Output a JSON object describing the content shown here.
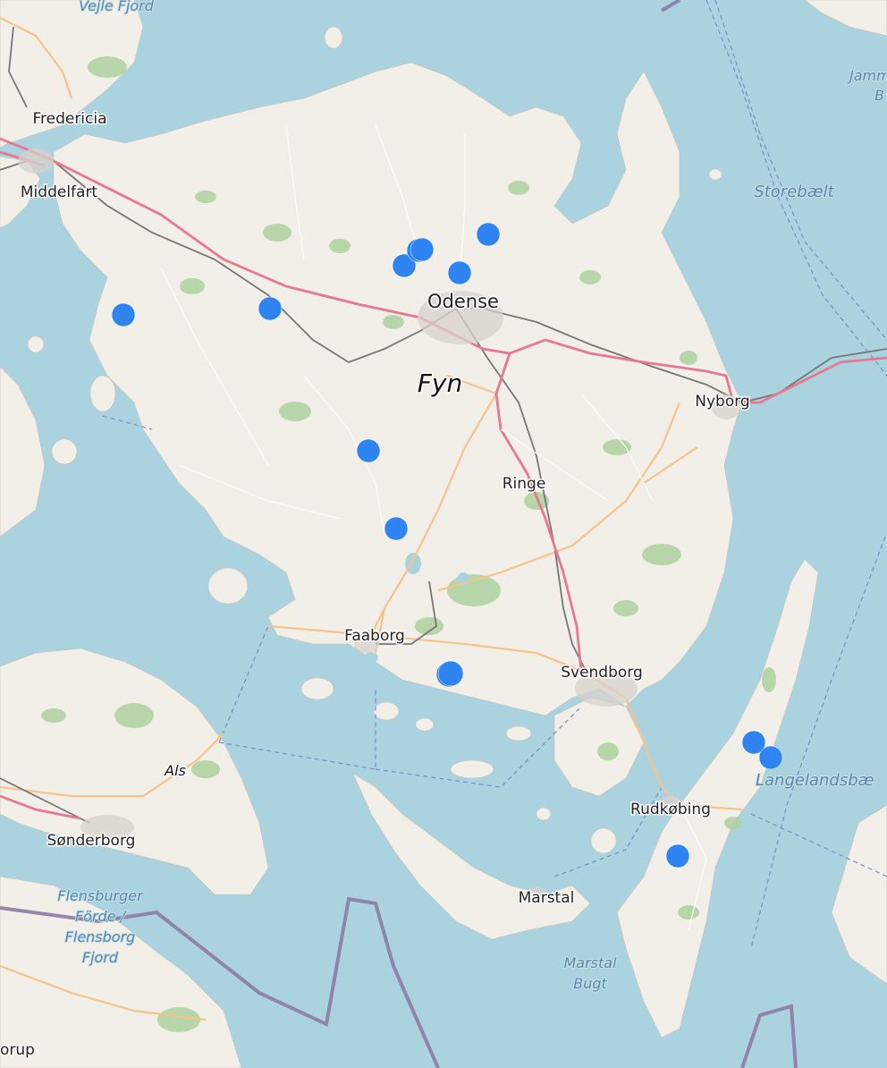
{
  "map": {
    "place_labels": {
      "fredericia": "Fredericia",
      "middelfart": "Middelfart",
      "odense": "Odense",
      "fyn": "Fyn",
      "nyborg": "Nyborg",
      "ringe": "Ringe",
      "faaborg": "Faaborg",
      "svendborg": "Svendborg",
      "rudkobing": "Rudkøbing",
      "marstal": "Marstal",
      "als": "Als",
      "sonderborg": "Sønderborg",
      "orup": "orup"
    },
    "water_labels": {
      "vejle_fjord": "Vejle Fjord",
      "storebaelt": "Storebælt",
      "langelandsbaelt": "Langelandsbæ",
      "flensburger_1": "Flensburger",
      "flensburger_2": "Förde /",
      "flensburger_3": "Flensborg",
      "flensburger_4": "Fjord",
      "marstal_bugt_1": "Marstal",
      "marstal_bugt_2": "Bugt",
      "jammer_1": "Jamm",
      "jammer_2": "B"
    },
    "colors": {
      "water": "#aad3df",
      "land": "#f2efe9",
      "forest": "#add19e",
      "motorway": "#e8788f",
      "trunk": "#f6c38a",
      "railway": "#777777",
      "border": "#8e7aa3",
      "marker": "#2f84f1"
    },
    "marker_count": 14
  }
}
